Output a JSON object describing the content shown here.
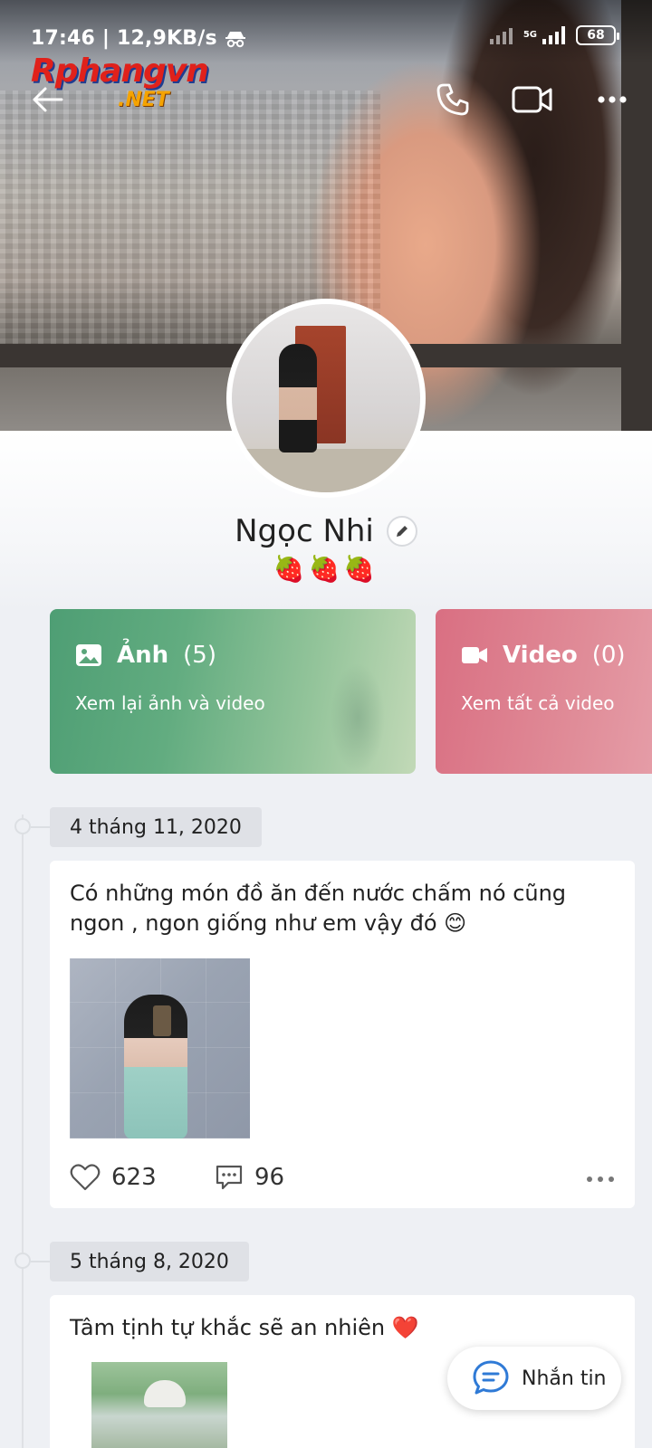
{
  "status_bar": {
    "time_speed": "17:46 | 12,9KB/s",
    "network": "5G",
    "battery": "68"
  },
  "watermark": {
    "main": "Rphangvn",
    "sub": ".NET"
  },
  "profile": {
    "name": "Ngọc Nhi",
    "status_emoji": "🍓🍓🍓"
  },
  "media": {
    "photos": {
      "title": "Ảnh",
      "count": "(5)",
      "subtitle": "Xem lại ảnh và video"
    },
    "videos": {
      "title": "Video",
      "count": "(0)",
      "subtitle": "Xem tất cả video"
    }
  },
  "posts": [
    {
      "date": "4 tháng 11, 2020",
      "text": "Có những món đồ ăn đến nước chấm nó cũng ngon , ngon giống như em vậy đó 😊",
      "likes": "623",
      "comments": "96"
    },
    {
      "date": "5 tháng 8, 2020",
      "text": "Tâm tịnh tự khắc sẽ an nhiên ❤️"
    }
  ],
  "fab": {
    "label": "Nhắn tin"
  },
  "colors": {
    "photo_card": "#4e9e74",
    "video_card": "#d96f82",
    "background": "#eef0f4"
  }
}
